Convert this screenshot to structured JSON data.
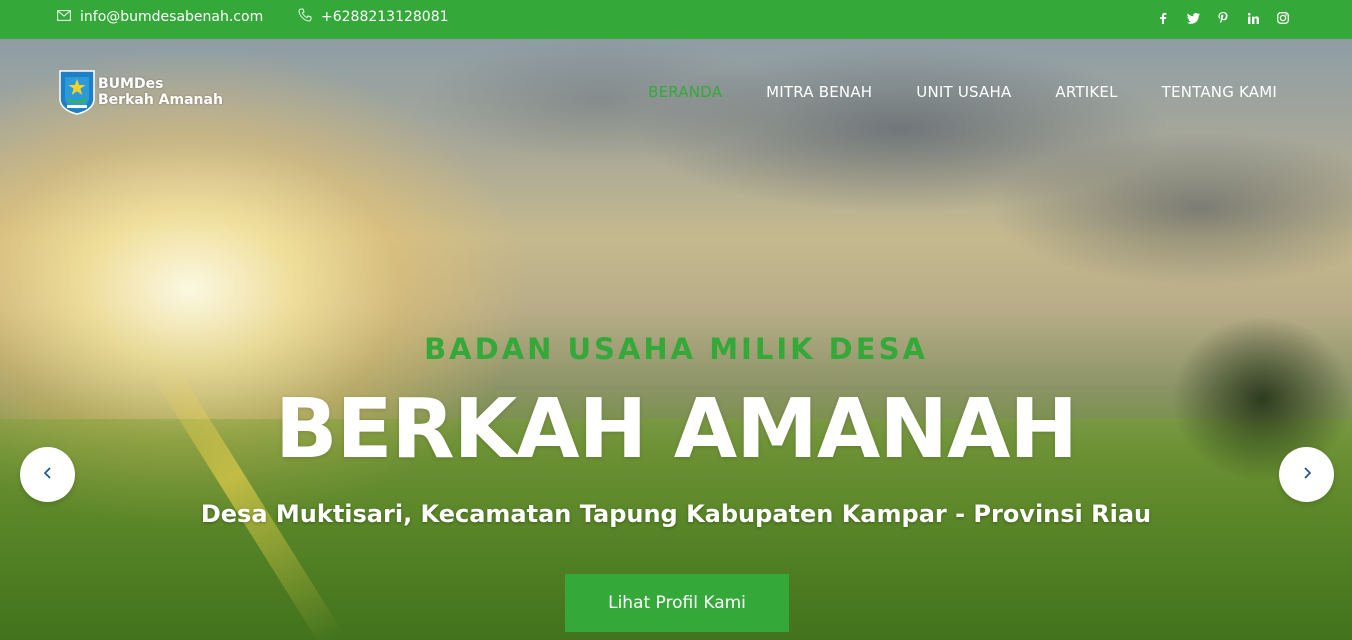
{
  "topbar": {
    "email": "info@bumdesabenah.com",
    "phone": "+6288213128081",
    "socials": [
      "facebook-icon",
      "twitter-icon",
      "pinterest-icon",
      "linkedin-icon",
      "instagram-icon"
    ]
  },
  "brand": {
    "line1": "BUMDes",
    "line2": "Berkah Amanah"
  },
  "nav": {
    "items": [
      {
        "label": "BERANDA",
        "active": true
      },
      {
        "label": "MITRA BENAH",
        "active": false
      },
      {
        "label": "UNIT USAHA",
        "active": false
      },
      {
        "label": "ARTIKEL",
        "active": false
      },
      {
        "label": "TENTANG KAMI",
        "active": false
      }
    ]
  },
  "hero": {
    "subtitle": "BADAN USAHA MILIK DESA",
    "headline": "BERKAH AMANAH",
    "tagline": "Desa Muktisari, Kecamatan Tapung Kabupaten Kampar - Provinsi Riau",
    "cta_label": "Lihat Profil Kami"
  },
  "colors": {
    "accent": "#34a93a",
    "topbar": "#34a93a",
    "text_light": "#ffffff"
  }
}
